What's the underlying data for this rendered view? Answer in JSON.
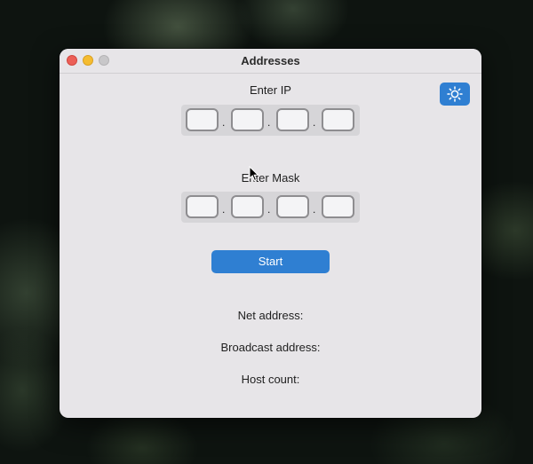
{
  "window": {
    "title": "Addresses"
  },
  "ip": {
    "label": "Enter IP",
    "octets": [
      "",
      "",
      "",
      ""
    ],
    "separator": "."
  },
  "mask": {
    "label": "Enter Mask",
    "octets": [
      "",
      "",
      "",
      ""
    ],
    "separator": "."
  },
  "actions": {
    "start_label": "Start",
    "theme_icon": "sun-icon"
  },
  "results": {
    "net_address_label": "Net address:",
    "broadcast_label": "Broadcast address:",
    "host_count_label": "Host count:"
  },
  "colors": {
    "accent": "#2f7fd2",
    "window_bg": "#e7e5e8",
    "field_group_bg": "#d6d5d8"
  }
}
